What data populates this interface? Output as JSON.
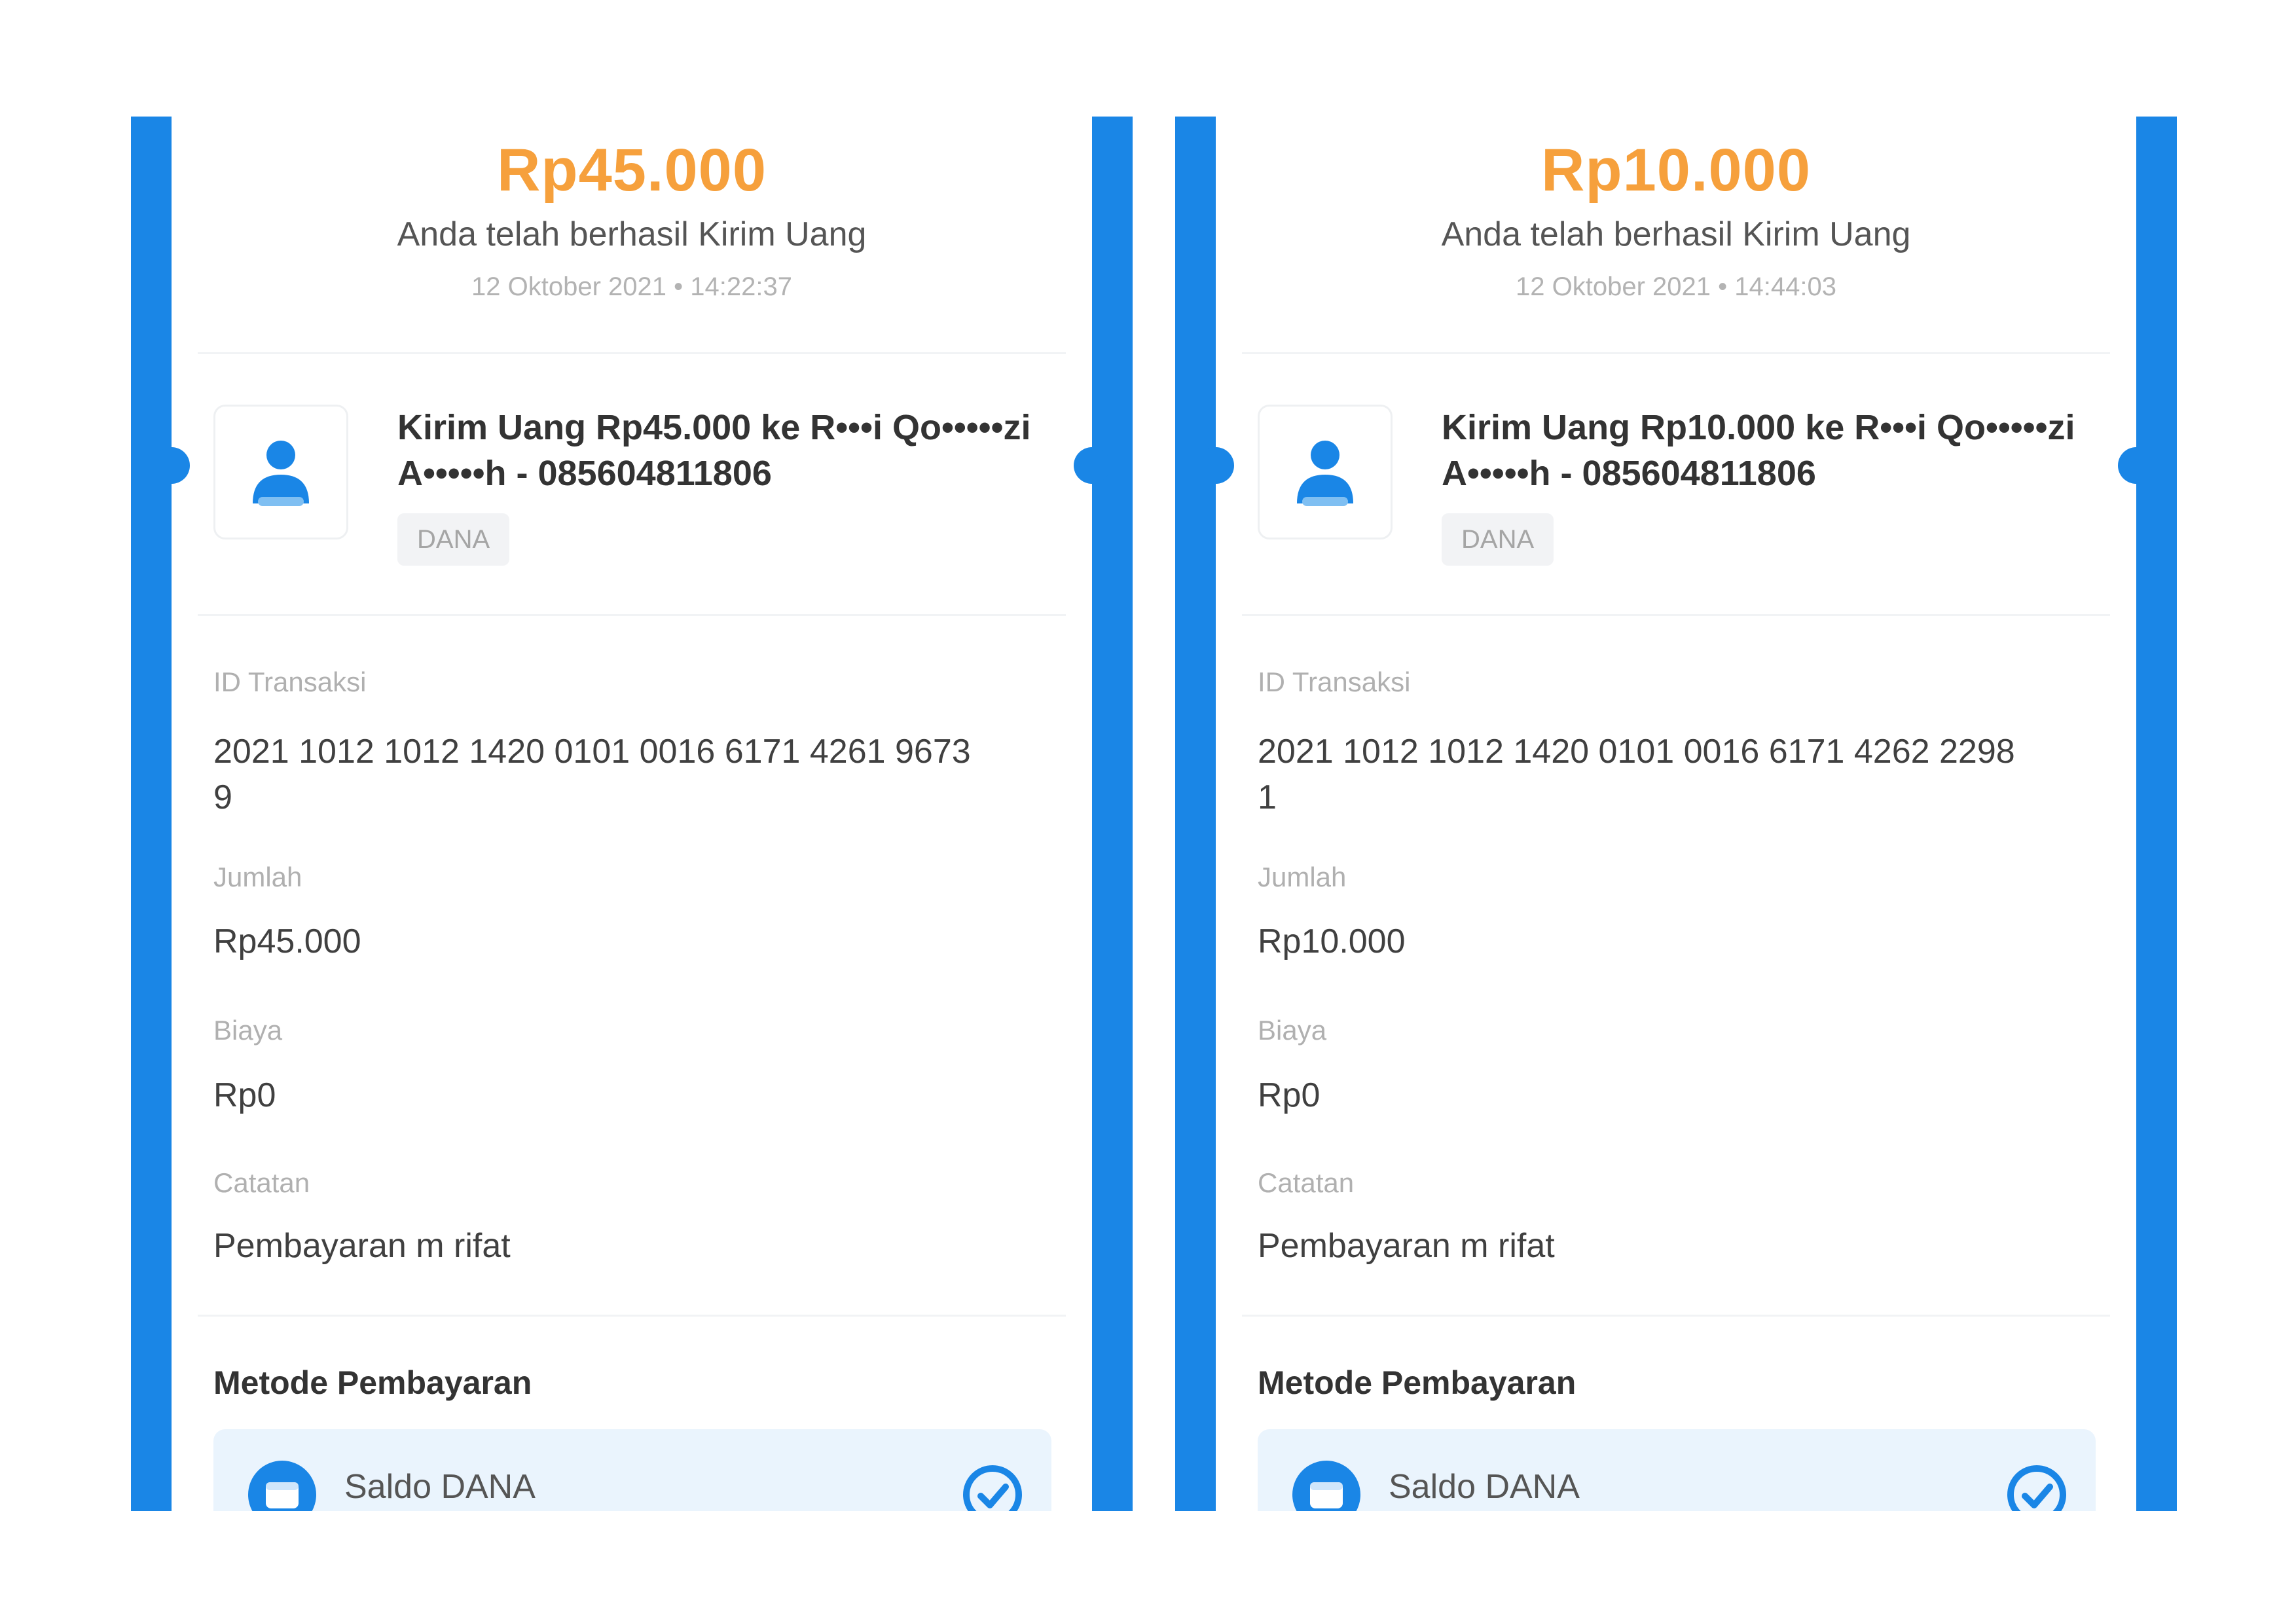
{
  "receipts": [
    {
      "amount": "Rp45.000",
      "subtitle": "Anda telah berhasil Kirim Uang",
      "datetime": "12 Oktober 2021 • 14:22:37",
      "transfer_title": "Kirim Uang Rp45.000 ke R•••i Qo•••••zi A•••••h - 085604811806",
      "tag": "DANA",
      "id_label": "ID Transaksi",
      "id_value": "2021 1012 1012 1420 0101 0016 6171 4261 9673 9",
      "amount_label": "Jumlah",
      "amount_value": "Rp45.000",
      "fee_label": "Biaya",
      "fee_value": "Rp0",
      "note_label": "Catatan",
      "note_value": "Pembayaran m rifat",
      "method_title": "Metode Pembayaran",
      "method_label": "Saldo DANA"
    },
    {
      "amount": "Rp10.000",
      "subtitle": "Anda telah berhasil Kirim Uang",
      "datetime": "12 Oktober 2021 • 14:44:03",
      "transfer_title": "Kirim Uang Rp10.000 ke R•••i Qo•••••zi A•••••h - 085604811806",
      "tag": "DANA",
      "id_label": "ID Transaksi",
      "id_value": "2021 1012 1012 1420 0101 0016 6171 4262 2298 1",
      "amount_label": "Jumlah",
      "amount_value": "Rp10.000",
      "fee_label": "Biaya",
      "fee_value": "Rp0",
      "note_label": "Catatan",
      "note_value": "Pembayaran m rifat",
      "method_title": "Metode Pembayaran",
      "method_label": "Saldo DANA"
    }
  ],
  "colors": {
    "brand_blue": "#1a86e6",
    "amount_orange": "#f6a03c",
    "method_bg": "#eaf4fd"
  },
  "icons": {
    "recipient": "person-icon",
    "wallet": "wallet-icon",
    "selected": "check-icon"
  }
}
